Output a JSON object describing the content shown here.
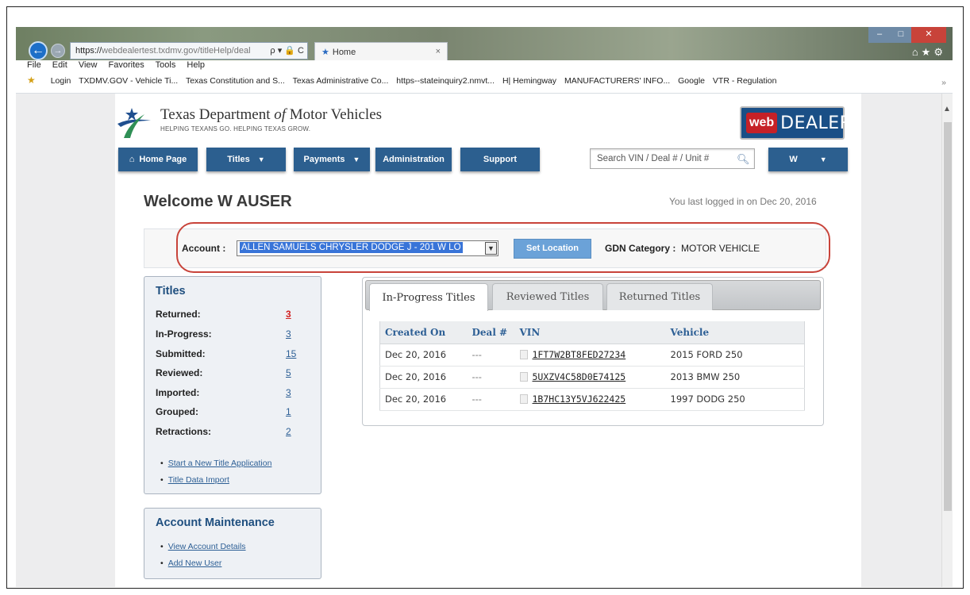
{
  "browser": {
    "url_prefix": "https://",
    "url_rest": "webdealertest.txdmv.gov/titleHelp/deal",
    "address_tools": "ρ ▾ 🔒 C",
    "tab_title": "Home",
    "menu": [
      "File",
      "Edit",
      "View",
      "Favorites",
      "Tools",
      "Help"
    ],
    "favorites": [
      "Login",
      "TXDMV.GOV - Vehicle Ti...",
      "Texas Constitution and S...",
      "Texas Administrative Co...",
      "https--stateinquiry2.nmvt...",
      "H| Hemingway",
      "MANUFACTURERS' INFO...",
      "Google",
      "VTR - Regulation"
    ]
  },
  "header": {
    "dept_name_part1": "Texas Department ",
    "dept_name_of": "of",
    "dept_name_part2": " Motor Vehicles",
    "tagline": "HELPING TEXANS GO. HELPING TEXAS GROW.",
    "webdealer_web": "web",
    "webdealer_dealer": "DEALER"
  },
  "nav": {
    "home": "Home Page",
    "titles": "Titles",
    "payments": "Payments",
    "administration": "Administration",
    "support": "Support",
    "search_placeholder": "Search VIN / Deal # / Unit #",
    "user": "W"
  },
  "welcome": {
    "title": "Welcome W AUSER",
    "last_login": "You last logged in on Dec 20, 2016"
  },
  "account": {
    "label": "Account :",
    "selected": "ALLEN SAMUELS CHRYSLER DODGE J - 201 W LO",
    "set_location": "Set Location",
    "gdn_label": "GDN Category :",
    "gdn_value": "MOTOR VEHICLE"
  },
  "titles_panel": {
    "heading": "Titles",
    "stats": [
      {
        "label": "Returned:",
        "value": "3"
      },
      {
        "label": "In-Progress:",
        "value": "3"
      },
      {
        "label": "Submitted:",
        "value": "15"
      },
      {
        "label": "Reviewed:",
        "value": "5"
      },
      {
        "label": "Imported:",
        "value": "3"
      },
      {
        "label": "Grouped:",
        "value": "1"
      },
      {
        "label": "Retractions:",
        "value": "2"
      }
    ],
    "links": [
      "Start a New Title Application",
      "Title Data Import"
    ]
  },
  "maintenance_panel": {
    "heading": "Account Maintenance",
    "links": [
      "View Account Details",
      "Add New User"
    ]
  },
  "tabs": [
    "In-Progress Titles",
    "Reviewed Titles",
    "Returned Titles"
  ],
  "table": {
    "headers": [
      "Created On",
      "Deal #",
      "VIN",
      "Vehicle"
    ],
    "rows": [
      {
        "created": "Dec 20, 2016",
        "deal": "---",
        "vin": "1FT7W2BT8FED27234",
        "vehicle": "2015 FORD 250"
      },
      {
        "created": "Dec 20, 2016",
        "deal": "---",
        "vin": "5UXZV4C58D0E74125",
        "vehicle": "2013 BMW 250"
      },
      {
        "created": "Dec 20, 2016",
        "deal": "---",
        "vin": "1B7HC13Y5VJ622425",
        "vehicle": "1997 DODG 250"
      }
    ]
  }
}
